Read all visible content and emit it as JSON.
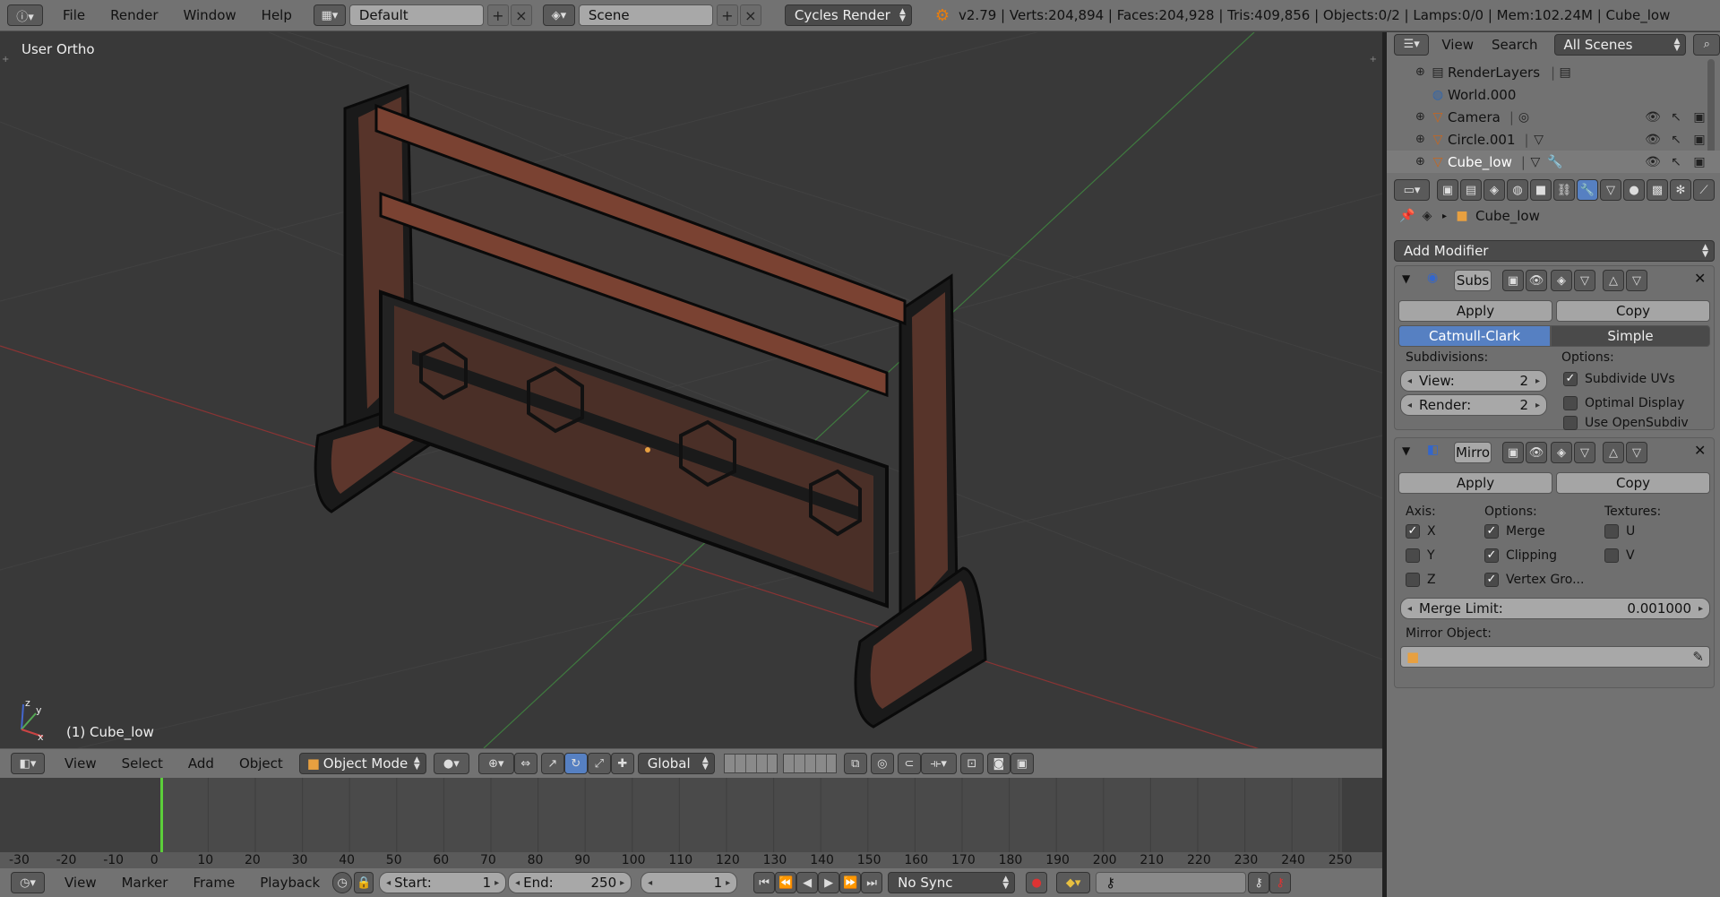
{
  "topbar": {
    "menus": [
      "File",
      "Render",
      "Window",
      "Help"
    ],
    "layout": "Default",
    "scene": "Scene",
    "engine": "Cycles Render",
    "stats": "v2.79 | Verts:204,894 | Faces:204,928 | Tris:409,856 | Objects:0/2 | Lamps:0/0 | Mem:102.24M | Cube_low"
  },
  "viewport": {
    "title": "User Ortho",
    "active_object": "(1) Cube_low",
    "axis_labels": {
      "y": "y",
      "z": "z",
      "x": "x"
    }
  },
  "view3d_header": {
    "menus": [
      "View",
      "Select",
      "Add",
      "Object"
    ],
    "mode": "Object Mode",
    "orientation": "Global"
  },
  "timeline": {
    "ruler_labels": [
      "-30",
      "-20",
      "-10",
      "0",
      "10",
      "20",
      "30",
      "40",
      "50",
      "60",
      "70",
      "80",
      "90",
      "100",
      "110",
      "120",
      "130",
      "140",
      "150",
      "160",
      "170",
      "180",
      "190",
      "200",
      "210",
      "220",
      "230",
      "240",
      "250"
    ],
    "current_frame_marker": 0
  },
  "timeline_header": {
    "menus": [
      "View",
      "Marker",
      "Frame",
      "Playback"
    ],
    "start_label": "Start:",
    "start_value": "1",
    "end_label": "End:",
    "end_value": "250",
    "current_frame": "1",
    "sync": "No Sync"
  },
  "outliner": {
    "menus": [
      "View",
      "Search"
    ],
    "filter": "All Scenes",
    "items": [
      {
        "name": "RenderLayers",
        "icon": "render-layers-icon"
      },
      {
        "name": "World.000",
        "icon": "world-icon"
      },
      {
        "name": "Camera",
        "icon": "camera-icon"
      },
      {
        "name": "Circle.001",
        "icon": "mesh-icon"
      },
      {
        "name": "Cube_low",
        "icon": "mesh-icon"
      }
    ]
  },
  "properties": {
    "object_name": "Cube_low",
    "add_modifier": "Add Modifier",
    "subsurf": {
      "name": "Subs",
      "apply": "Apply",
      "copy": "Copy",
      "tab_active": "Catmull-Clark",
      "tab_other": "Simple",
      "subdivisions_label": "Subdivisions:",
      "view_label": "View:",
      "view_value": "2",
      "render_label": "Render:",
      "render_value": "2",
      "options_label": "Options:",
      "opt1": "Subdivide UVs",
      "opt2": "Optimal Display",
      "opt3": "Use OpenSubdiv"
    },
    "mirror": {
      "name": "Mirro",
      "apply": "Apply",
      "copy": "Copy",
      "axis_label": "Axis:",
      "options_label": "Options:",
      "textures_label": "Textures:",
      "x": "X",
      "y": "Y",
      "z": "Z",
      "merge": "Merge",
      "clipping": "Clipping",
      "vertex_groups": "Vertex Gro...",
      "u": "U",
      "v": "V",
      "merge_limit_label": "Merge Limit:",
      "merge_limit_value": "0.001000",
      "mirror_object_label": "Mirror Object:"
    }
  },
  "colors": {
    "accent_blue": "#5680c2",
    "mesh_orange": "#c2644a",
    "frame_green": "#5ccf3a"
  }
}
